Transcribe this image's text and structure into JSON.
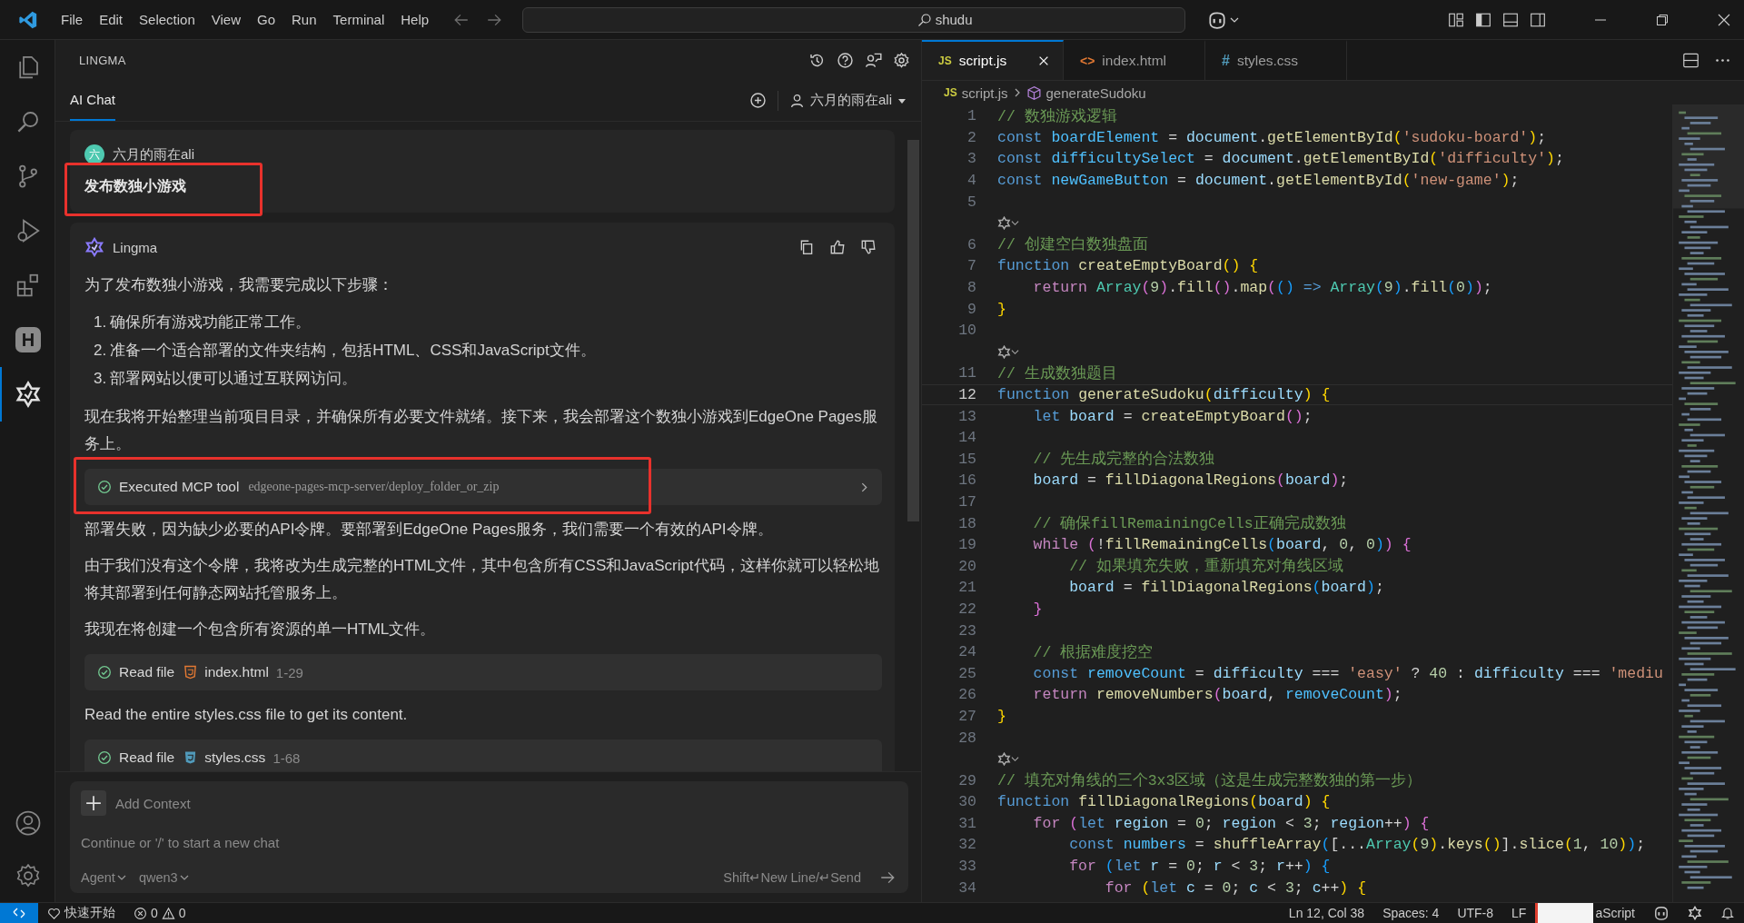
{
  "title_bar": {
    "menu": [
      "File",
      "Edit",
      "Selection",
      "View",
      "Go",
      "Run",
      "Terminal",
      "Help"
    ],
    "search": "shudu"
  },
  "activity_bar": {
    "items": [
      {
        "selected": false
      },
      {
        "selected": false
      },
      {
        "selected": false
      },
      {
        "selected": false
      },
      {
        "selected": false
      },
      {
        "text": "H",
        "selected": false
      },
      {
        "selected": true
      }
    ]
  },
  "chat_panel": {
    "title": "LINGMA",
    "tabs": [
      {
        "label": "AI Chat",
        "selected": true
      }
    ],
    "user": "六月的雨在ali",
    "messages": [
      {
        "kind": "user",
        "avatar": "六",
        "name": "六月的雨在ali",
        "text": "发布数独小游戏",
        "highlighted": true
      },
      {
        "kind": "assistant",
        "name": "Lingma",
        "blocks": [
          {
            "kind": "text",
            "text": "为了发布数独小游戏，我需要完成以下步骤："
          },
          {
            "kind": "list",
            "items": [
              {
                "num": "1.",
                "text": "确保所有游戏功能正常工作。"
              },
              {
                "num": "2.",
                "text": "准备一个适合部署的文件夹结构，包括HTML、CSS和JavaScript文件。"
              },
              {
                "num": "3.",
                "text": "部署网站以便可以通过互联网访问。"
              }
            ]
          },
          {
            "kind": "text",
            "text": "现在我将开始整理当前项目目录，并确保所有必要文件就绪。接下来，我会部署这个数独小游戏到EdgeOne Pages服务上。"
          },
          {
            "kind": "mcp",
            "label": "Executed MCP tool",
            "detail": "edgeone-pages-mcp-server/deploy_folder_or_zip",
            "highlighted": true
          },
          {
            "kind": "text",
            "text": "部署失败，因为缺少必要的API令牌。要部署到EdgeOne Pages服务，我们需要一个有效的API令牌。"
          },
          {
            "kind": "text",
            "text": "由于我们没有这个令牌，我将改为生成完整的HTML文件，其中包含所有CSS和JavaScript代码，这样你就可以轻松地将其部署到任何静态网站托管服务上。"
          },
          {
            "kind": "text",
            "text": "我现在将创建一个包含所有资源的单一HTML文件。"
          },
          {
            "kind": "read_html",
            "label": "Read file",
            "file": "index.html",
            "range": "1-29",
            "highlighted": false
          },
          {
            "kind": "text",
            "text": "Read the entire styles.css file to get its content."
          },
          {
            "kind": "read_css",
            "label": "Read file",
            "file": "styles.css",
            "range": "1-68",
            "highlighted": false
          }
        ]
      }
    ],
    "input": {
      "add_context": "Add Context",
      "placeholder": "Continue or '/' to start a new chat",
      "mode": "Agent",
      "model": "qwen3",
      "hint": "Shift↵New Line/↵Send"
    }
  },
  "editor": {
    "tabs": [
      {
        "icon": "JS",
        "label": "script.js",
        "kind": "js",
        "selected": true
      },
      {
        "icon": "<>",
        "label": "index.html",
        "kind": "html",
        "selected": false
      },
      {
        "icon": "#",
        "label": "styles.css",
        "kind": "css",
        "selected": false
      }
    ],
    "breadcrumb": {
      "icon": "JS",
      "file": "script.js",
      "symbol": "generateSudoku"
    },
    "lines": [
      {
        "kind": "code",
        "n": "1",
        "current": false,
        "tokens": [
          {
            "kind": "cm",
            "text": "// 数独游戏逻辑"
          }
        ]
      },
      {
        "kind": "code",
        "n": "2",
        "current": false,
        "tokens": [
          {
            "kind": "kw",
            "text": "const "
          },
          {
            "kind": "cst",
            "text": "boardElement"
          },
          {
            "kind": "p",
            "text": " = "
          },
          {
            "kind": "var",
            "text": "document"
          },
          {
            "kind": "p",
            "text": "."
          },
          {
            "kind": "fn",
            "text": "getElementById"
          },
          {
            "kind": "b1",
            "text": "("
          },
          {
            "kind": "str",
            "text": "'sudoku-board'"
          },
          {
            "kind": "b1",
            "text": ")"
          },
          {
            "kind": "p",
            "text": ";"
          }
        ]
      },
      {
        "kind": "code",
        "n": "3",
        "current": false,
        "tokens": [
          {
            "kind": "kw",
            "text": "const "
          },
          {
            "kind": "cst",
            "text": "difficultySelect"
          },
          {
            "kind": "p",
            "text": " = "
          },
          {
            "kind": "var",
            "text": "document"
          },
          {
            "kind": "p",
            "text": "."
          },
          {
            "kind": "fn",
            "text": "getElementById"
          },
          {
            "kind": "b1",
            "text": "("
          },
          {
            "kind": "str",
            "text": "'difficulty'"
          },
          {
            "kind": "b1",
            "text": ")"
          },
          {
            "kind": "p",
            "text": ";"
          }
        ]
      },
      {
        "kind": "code",
        "n": "4",
        "current": false,
        "tokens": [
          {
            "kind": "kw",
            "text": "const "
          },
          {
            "kind": "cst",
            "text": "newGameButton"
          },
          {
            "kind": "p",
            "text": " = "
          },
          {
            "kind": "var",
            "text": "document"
          },
          {
            "kind": "p",
            "text": "."
          },
          {
            "kind": "fn",
            "text": "getElementById"
          },
          {
            "kind": "b1",
            "text": "("
          },
          {
            "kind": "str",
            "text": "'new-game'"
          },
          {
            "kind": "b1",
            "text": ")"
          },
          {
            "kind": "p",
            "text": ";"
          }
        ]
      },
      {
        "kind": "code",
        "n": "5",
        "current": false
      },
      {
        "kind": "lens"
      },
      {
        "kind": "code",
        "n": "6",
        "current": false,
        "tokens": [
          {
            "kind": "cm",
            "text": "// 创建空白数独盘面"
          }
        ]
      },
      {
        "kind": "code",
        "n": "7",
        "current": false,
        "tokens": [
          {
            "kind": "kw",
            "text": "function "
          },
          {
            "kind": "fn",
            "text": "createEmptyBoard"
          },
          {
            "kind": "b1",
            "text": "()"
          },
          {
            "kind": "b1",
            "text": " {"
          }
        ]
      },
      {
        "kind": "code",
        "n": "8",
        "current": false,
        "tokens": [
          {
            "kind": "ctl",
            "text": "    return "
          },
          {
            "kind": "cls",
            "text": "Array"
          },
          {
            "kind": "b2",
            "text": "("
          },
          {
            "kind": "num",
            "text": "9"
          },
          {
            "kind": "b2",
            "text": ")"
          },
          {
            "kind": "p",
            "text": "."
          },
          {
            "kind": "fn",
            "text": "fill"
          },
          {
            "kind": "b2",
            "text": "()"
          },
          {
            "kind": "p",
            "text": "."
          },
          {
            "kind": "fn",
            "text": "map"
          },
          {
            "kind": "b2",
            "text": "("
          },
          {
            "kind": "b3",
            "text": "()"
          },
          {
            "kind": "kw",
            "text": " => "
          },
          {
            "kind": "cls",
            "text": "Array"
          },
          {
            "kind": "b3",
            "text": "("
          },
          {
            "kind": "num",
            "text": "9"
          },
          {
            "kind": "b3",
            "text": ")"
          },
          {
            "kind": "p",
            "text": "."
          },
          {
            "kind": "fn",
            "text": "fill"
          },
          {
            "kind": "b3",
            "text": "("
          },
          {
            "kind": "num",
            "text": "0"
          },
          {
            "kind": "b3",
            "text": ")"
          },
          {
            "kind": "b2",
            "text": ")"
          },
          {
            "kind": "p",
            "text": ";"
          }
        ]
      },
      {
        "kind": "code",
        "n": "9",
        "current": false,
        "tokens": [
          {
            "kind": "b1",
            "text": "}"
          }
        ]
      },
      {
        "kind": "code",
        "n": "10",
        "current": false
      },
      {
        "kind": "lens"
      },
      {
        "kind": "code",
        "n": "11",
        "current": false,
        "tokens": [
          {
            "kind": "cm",
            "text": "// 生成数独题目"
          }
        ]
      },
      {
        "kind": "code",
        "n": "12",
        "current": true,
        "tokens": [
          {
            "kind": "kw",
            "text": "function "
          },
          {
            "kind": "fn",
            "text": "generateSudoku"
          },
          {
            "kind": "b1",
            "text": "("
          },
          {
            "kind": "var",
            "text": "difficulty"
          },
          {
            "kind": "b1",
            "text": ")"
          },
          {
            "kind": "b1",
            "text": " {"
          }
        ]
      },
      {
        "kind": "code",
        "n": "13",
        "current": false,
        "tokens": [
          {
            "kind": "kw",
            "text": "    let "
          },
          {
            "kind": "var",
            "text": "board"
          },
          {
            "kind": "p",
            "text": " = "
          },
          {
            "kind": "fn",
            "text": "createEmptyBoard"
          },
          {
            "kind": "b2",
            "text": "()"
          },
          {
            "kind": "p",
            "text": ";"
          }
        ]
      },
      {
        "kind": "code",
        "n": "14",
        "current": false
      },
      {
        "kind": "code",
        "n": "15",
        "current": false,
        "tokens": [
          {
            "kind": "cm",
            "text": "    // 先生成完整的合法数独"
          }
        ]
      },
      {
        "kind": "code",
        "n": "16",
        "current": false,
        "tokens": [
          {
            "kind": "var",
            "text": "    board"
          },
          {
            "kind": "p",
            "text": " = "
          },
          {
            "kind": "fn",
            "text": "fillDiagonalRegions"
          },
          {
            "kind": "b2",
            "text": "("
          },
          {
            "kind": "var",
            "text": "board"
          },
          {
            "kind": "b2",
            "text": ")"
          },
          {
            "kind": "p",
            "text": ";"
          }
        ]
      },
      {
        "kind": "code",
        "n": "17",
        "current": false
      },
      {
        "kind": "code",
        "n": "18",
        "current": false,
        "tokens": [
          {
            "kind": "cm",
            "text": "    // 确保fillRemainingCells正确完成数独"
          }
        ]
      },
      {
        "kind": "code",
        "n": "19",
        "current": false,
        "tokens": [
          {
            "kind": "ctl",
            "text": "    while "
          },
          {
            "kind": "b2",
            "text": "("
          },
          {
            "kind": "p",
            "text": "!"
          },
          {
            "kind": "fn",
            "text": "fillRemainingCells"
          },
          {
            "kind": "b3",
            "text": "("
          },
          {
            "kind": "var",
            "text": "board"
          },
          {
            "kind": "p",
            "text": ", "
          },
          {
            "kind": "num",
            "text": "0"
          },
          {
            "kind": "p",
            "text": ", "
          },
          {
            "kind": "num",
            "text": "0"
          },
          {
            "kind": "b3",
            "text": ")"
          },
          {
            "kind": "b2",
            "text": ")"
          },
          {
            "kind": "b2",
            "text": " {"
          }
        ]
      },
      {
        "kind": "code",
        "n": "20",
        "current": false,
        "tokens": [
          {
            "kind": "cm",
            "text": "        // 如果填充失败，重新填充对角线区域"
          }
        ]
      },
      {
        "kind": "code",
        "n": "21",
        "current": false,
        "tokens": [
          {
            "kind": "var",
            "text": "        board"
          },
          {
            "kind": "p",
            "text": " = "
          },
          {
            "kind": "fn",
            "text": "fillDiagonalRegions"
          },
          {
            "kind": "b3",
            "text": "("
          },
          {
            "kind": "var",
            "text": "board"
          },
          {
            "kind": "b3",
            "text": ")"
          },
          {
            "kind": "p",
            "text": ";"
          }
        ]
      },
      {
        "kind": "code",
        "n": "22",
        "current": false,
        "tokens": [
          {
            "kind": "b2",
            "text": "    }"
          }
        ]
      },
      {
        "kind": "code",
        "n": "23",
        "current": false
      },
      {
        "kind": "code",
        "n": "24",
        "current": false,
        "tokens": [
          {
            "kind": "cm",
            "text": "    // 根据难度挖空"
          }
        ]
      },
      {
        "kind": "code",
        "n": "25",
        "current": false,
        "tokens": [
          {
            "kind": "kw",
            "text": "    const "
          },
          {
            "kind": "cst",
            "text": "removeCount"
          },
          {
            "kind": "p",
            "text": " = "
          },
          {
            "kind": "var",
            "text": "difficulty"
          },
          {
            "kind": "p",
            "text": " === "
          },
          {
            "kind": "str",
            "text": "'easy'"
          },
          {
            "kind": "p",
            "text": " ? "
          },
          {
            "kind": "num",
            "text": "40"
          },
          {
            "kind": "p",
            "text": " : "
          },
          {
            "kind": "var",
            "text": "difficulty"
          },
          {
            "kind": "p",
            "text": " === "
          },
          {
            "kind": "str",
            "text": "'mediu"
          }
        ]
      },
      {
        "kind": "code",
        "n": "26",
        "current": false,
        "tokens": [
          {
            "kind": "ctl",
            "text": "    return "
          },
          {
            "kind": "fn",
            "text": "removeNumbers"
          },
          {
            "kind": "b2",
            "text": "("
          },
          {
            "kind": "var",
            "text": "board"
          },
          {
            "kind": "p",
            "text": ", "
          },
          {
            "kind": "cst",
            "text": "removeCount"
          },
          {
            "kind": "b2",
            "text": ")"
          },
          {
            "kind": "p",
            "text": ";"
          }
        ]
      },
      {
        "kind": "code",
        "n": "27",
        "current": false,
        "tokens": [
          {
            "kind": "b1",
            "text": "}"
          }
        ]
      },
      {
        "kind": "code",
        "n": "28",
        "current": false
      },
      {
        "kind": "lens"
      },
      {
        "kind": "code",
        "n": "29",
        "current": false,
        "tokens": [
          {
            "kind": "cm",
            "text": "// 填充对角线的三个3x3区域（这是生成完整数独的第一步）"
          }
        ]
      },
      {
        "kind": "code",
        "n": "30",
        "current": false,
        "tokens": [
          {
            "kind": "kw",
            "text": "function "
          },
          {
            "kind": "fn",
            "text": "fillDiagonalRegions"
          },
          {
            "kind": "b1",
            "text": "("
          },
          {
            "kind": "var",
            "text": "board"
          },
          {
            "kind": "b1",
            "text": ")"
          },
          {
            "kind": "b1",
            "text": " {"
          }
        ]
      },
      {
        "kind": "code",
        "n": "31",
        "current": false,
        "tokens": [
          {
            "kind": "ctl",
            "text": "    for "
          },
          {
            "kind": "b2",
            "text": "("
          },
          {
            "kind": "kw",
            "text": "let "
          },
          {
            "kind": "var",
            "text": "region"
          },
          {
            "kind": "p",
            "text": " = "
          },
          {
            "kind": "num",
            "text": "0"
          },
          {
            "kind": "p",
            "text": "; "
          },
          {
            "kind": "var",
            "text": "region"
          },
          {
            "kind": "p",
            "text": " < "
          },
          {
            "kind": "num",
            "text": "3"
          },
          {
            "kind": "p",
            "text": "; "
          },
          {
            "kind": "var",
            "text": "region"
          },
          {
            "kind": "p",
            "text": "++"
          },
          {
            "kind": "b2",
            "text": ")"
          },
          {
            "kind": "b2",
            "text": " {"
          }
        ]
      },
      {
        "kind": "code",
        "n": "32",
        "current": false,
        "tokens": [
          {
            "kind": "kw",
            "text": "        const "
          },
          {
            "kind": "cst",
            "text": "numbers"
          },
          {
            "kind": "p",
            "text": " = "
          },
          {
            "kind": "fn",
            "text": "shuffleArray"
          },
          {
            "kind": "b3",
            "text": "("
          },
          {
            "kind": "p",
            "text": "[..."
          },
          {
            "kind": "cls",
            "text": "Array"
          },
          {
            "kind": "b1",
            "text": "("
          },
          {
            "kind": "num",
            "text": "9"
          },
          {
            "kind": "b1",
            "text": ")"
          },
          {
            "kind": "p",
            "text": "."
          },
          {
            "kind": "fn",
            "text": "keys"
          },
          {
            "kind": "b1",
            "text": "()"
          },
          {
            "kind": "p",
            "text": "]."
          },
          {
            "kind": "fn",
            "text": "slice"
          },
          {
            "kind": "b1",
            "text": "("
          },
          {
            "kind": "num",
            "text": "1"
          },
          {
            "kind": "p",
            "text": ", "
          },
          {
            "kind": "num",
            "text": "10"
          },
          {
            "kind": "b1",
            "text": ")"
          },
          {
            "kind": "b3",
            "text": ")"
          },
          {
            "kind": "p",
            "text": ";"
          }
        ]
      },
      {
        "kind": "code",
        "n": "33",
        "current": false,
        "tokens": [
          {
            "kind": "ctl",
            "text": "        for "
          },
          {
            "kind": "b3",
            "text": "("
          },
          {
            "kind": "kw",
            "text": "let "
          },
          {
            "kind": "var",
            "text": "r"
          },
          {
            "kind": "p",
            "text": " = "
          },
          {
            "kind": "num",
            "text": "0"
          },
          {
            "kind": "p",
            "text": "; "
          },
          {
            "kind": "var",
            "text": "r"
          },
          {
            "kind": "p",
            "text": " < "
          },
          {
            "kind": "num",
            "text": "3"
          },
          {
            "kind": "p",
            "text": "; "
          },
          {
            "kind": "var",
            "text": "r"
          },
          {
            "kind": "p",
            "text": "++"
          },
          {
            "kind": "b3",
            "text": ")"
          },
          {
            "kind": "b3",
            "text": " {"
          }
        ]
      },
      {
        "kind": "code",
        "n": "34",
        "current": false,
        "tokens": [
          {
            "kind": "ctl",
            "text": "            for "
          },
          {
            "kind": "b1",
            "text": "("
          },
          {
            "kind": "kw",
            "text": "let "
          },
          {
            "kind": "var",
            "text": "c"
          },
          {
            "kind": "p",
            "text": " = "
          },
          {
            "kind": "num",
            "text": "0"
          },
          {
            "kind": "p",
            "text": "; "
          },
          {
            "kind": "var",
            "text": "c"
          },
          {
            "kind": "p",
            "text": " < "
          },
          {
            "kind": "num",
            "text": "3"
          },
          {
            "kind": "p",
            "text": "; "
          },
          {
            "kind": "var",
            "text": "c"
          },
          {
            "kind": "p",
            "text": "++"
          },
          {
            "kind": "b1",
            "text": ")"
          },
          {
            "kind": "b1",
            "text": " {"
          }
        ]
      }
    ]
  },
  "status_bar": {
    "quick_start": "快速开始",
    "errors": "0",
    "warnings": "0",
    "items": [
      "Ln 12, Col 38",
      "Spaces: 4",
      "UTF-8",
      "LF"
    ],
    "language": "aScript"
  }
}
